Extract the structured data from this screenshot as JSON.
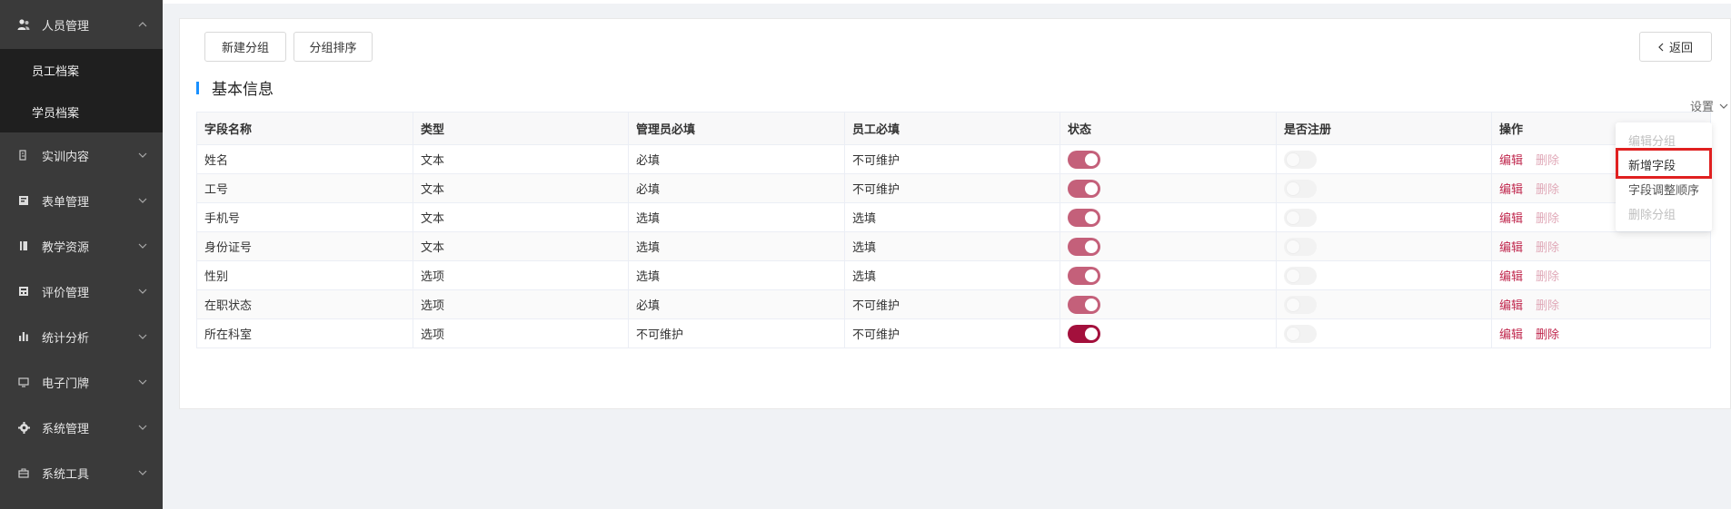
{
  "colors": {
    "sidebar_bg": "#3a3a3a",
    "submenu_bg": "#1f1f1f",
    "accent_blue": "#1890ff",
    "toggle_on": "#c4607a",
    "toggle_on_dark": "#a3103c",
    "link_edit": "#c0284e",
    "link_disabled": "#e0a9b8",
    "highlight_red": "#e02020"
  },
  "sidebar": {
    "groups": [
      {
        "label": "人员管理",
        "icon": "user-group-icon",
        "expanded": true,
        "children": [
          {
            "label": "员工档案"
          },
          {
            "label": "学员档案"
          }
        ]
      },
      {
        "label": "实训内容",
        "icon": "training-icon"
      },
      {
        "label": "表单管理",
        "icon": "form-icon"
      },
      {
        "label": "教学资源",
        "icon": "book-icon"
      },
      {
        "label": "评价管理",
        "icon": "evaluation-icon"
      },
      {
        "label": "统计分析",
        "icon": "bar-chart-icon"
      },
      {
        "label": "电子门牌",
        "icon": "monitor-icon"
      },
      {
        "label": "系统管理",
        "icon": "gear-icon"
      },
      {
        "label": "系统工具",
        "icon": "toolbox-icon"
      }
    ]
  },
  "toolbar": {
    "new_group": "新建分组",
    "group_sort": "分组排序",
    "back": "返回"
  },
  "section": {
    "title": "基本信息"
  },
  "settings": {
    "label": "设置"
  },
  "table": {
    "headers": [
      "字段名称",
      "类型",
      "管理员必填",
      "员工必填",
      "状态",
      "是否注册",
      "操作"
    ],
    "rows": [
      {
        "name": "姓名",
        "type": "文本",
        "admin": "必填",
        "staff": "不可维护",
        "status": "on",
        "registered": "off",
        "delete_enabled": false
      },
      {
        "name": "工号",
        "type": "文本",
        "admin": "必填",
        "staff": "不可维护",
        "status": "on",
        "registered": "off",
        "delete_enabled": false
      },
      {
        "name": "手机号",
        "type": "文本",
        "admin": "选填",
        "staff": "选填",
        "status": "on",
        "registered": "off",
        "delete_enabled": false
      },
      {
        "name": "身份证号",
        "type": "文本",
        "admin": "选填",
        "staff": "选填",
        "status": "on",
        "registered": "off",
        "delete_enabled": false
      },
      {
        "name": "性别",
        "type": "选项",
        "admin": "选填",
        "staff": "选填",
        "status": "on",
        "registered": "off",
        "delete_enabled": false
      },
      {
        "name": "在职状态",
        "type": "选项",
        "admin": "必填",
        "staff": "不可维护",
        "status": "on",
        "registered": "off",
        "delete_enabled": false
      },
      {
        "name": "所在科室",
        "type": "选项",
        "admin": "不可维护",
        "staff": "不可维护",
        "status": "on-dark",
        "registered": "off",
        "delete_enabled": true
      }
    ],
    "edit_label": "编辑",
    "delete_label": "删除"
  },
  "dropdown": {
    "items": [
      {
        "label": "编辑分组",
        "disabled": true
      },
      {
        "label": "新增字段",
        "disabled": false,
        "highlighted": true
      },
      {
        "label": "字段调整顺序",
        "disabled": false
      },
      {
        "label": "删除分组",
        "disabled": true
      }
    ]
  }
}
